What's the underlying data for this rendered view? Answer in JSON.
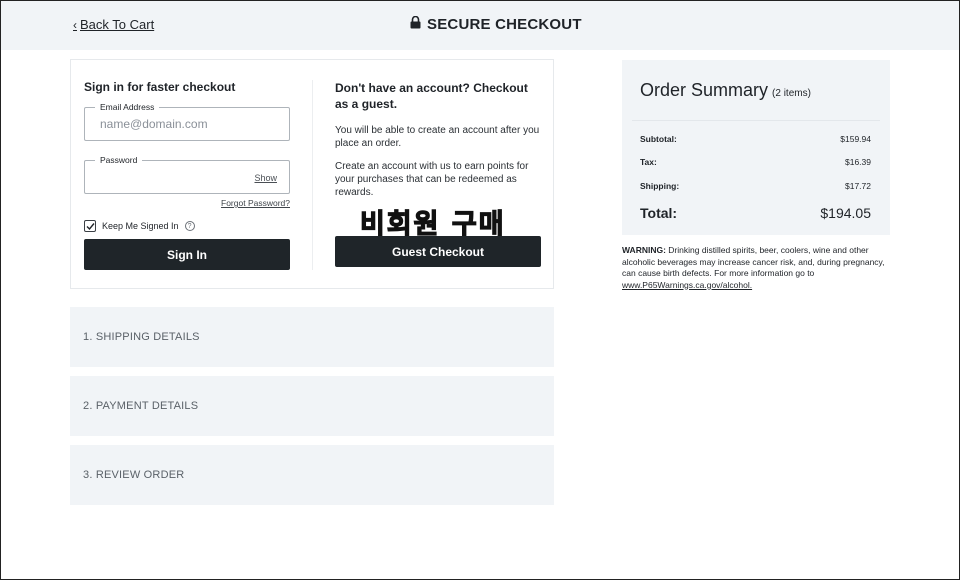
{
  "header": {
    "back_label": "Back To Cart",
    "title": "SECURE CHECKOUT"
  },
  "signin": {
    "title": "Sign in for faster checkout",
    "email": {
      "label": "Email Address",
      "placeholder": "name@domain.com",
      "value": ""
    },
    "password": {
      "label": "Password",
      "value": "",
      "show_label": "Show"
    },
    "forgot_label": "Forgot Password?",
    "keep_signed_in_label": "Keep Me Signed In",
    "keep_signed_in_checked": true,
    "button_label": "Sign In"
  },
  "guest": {
    "title": "Don't have an account? Checkout as a guest.",
    "text_1": "You will be able to create an account after you place an order.",
    "text_2": "Create an account with us to earn points for your purchases that can be redeemed as rewards.",
    "overlay_text": "비회원 구매",
    "button_label": "Guest Checkout"
  },
  "steps": [
    {
      "label": "1. SHIPPING DETAILS"
    },
    {
      "label": "2. PAYMENT DETAILS"
    },
    {
      "label": "3. REVIEW ORDER"
    }
  ],
  "summary": {
    "title": "Order Summary",
    "count": "(2 items)",
    "rows": [
      {
        "label": "Subtotal:",
        "value": "$159.94"
      },
      {
        "label": "Tax:",
        "value": "$16.39"
      },
      {
        "label": "Shipping:",
        "value": "$17.72"
      }
    ],
    "total_label": "Total:",
    "total_value": "$194.05"
  },
  "warning": {
    "prefix": "WARNING:",
    "text": " Drinking distilled spirits, beer, coolers, wine and other alcoholic beverages may increase cancer risk, and, during pregnancy, can cause birth defects. For more information go to ",
    "link": "www.P65Warnings.ca.gov/alcohol."
  },
  "colors": {
    "header_bg": "#f1f4f7",
    "button_dark": "#1f2529",
    "panel_bg": "#f1f4f7"
  }
}
